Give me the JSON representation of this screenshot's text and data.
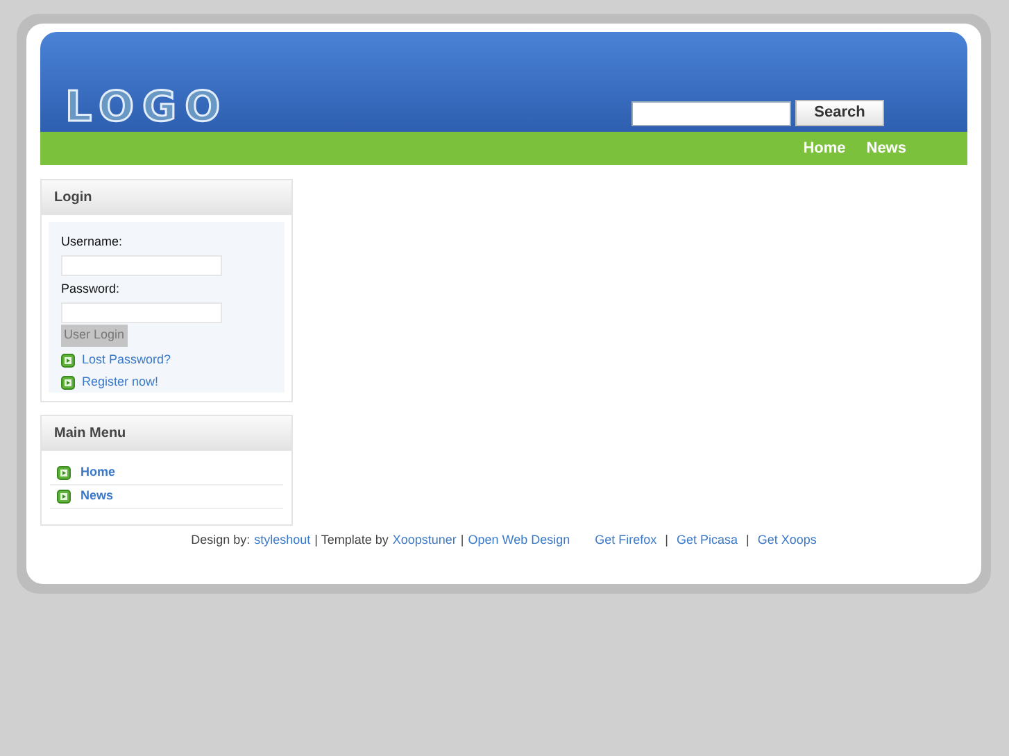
{
  "header": {
    "logo": "LOGO",
    "search": {
      "button": "Search"
    }
  },
  "nav": [
    "Home",
    "News"
  ],
  "login": {
    "title": "Login",
    "username_label": "Username:",
    "password_label": "Password:",
    "button": "User Login",
    "links": [
      "Lost Password?",
      "Register now!"
    ]
  },
  "main_menu": {
    "title": "Main Menu",
    "items": [
      "Home",
      "News"
    ]
  },
  "footer": {
    "credits": [
      {
        "kind": "text",
        "text": "Design by:"
      },
      {
        "kind": "link",
        "text": "styleshout"
      },
      {
        "kind": "text",
        "text": "| Template by"
      },
      {
        "kind": "link",
        "text": "Xoopstuner"
      },
      {
        "kind": "text",
        "text": "|"
      },
      {
        "kind": "link",
        "text": "Open Web Design"
      }
    ],
    "links": [
      {
        "kind": "link",
        "text": "Get Firefox"
      },
      {
        "kind": "text",
        "text": "|"
      },
      {
        "kind": "link",
        "text": "Get Picasa"
      },
      {
        "kind": "text",
        "text": "|"
      },
      {
        "kind": "link",
        "text": "Get Xoops"
      }
    ]
  }
}
